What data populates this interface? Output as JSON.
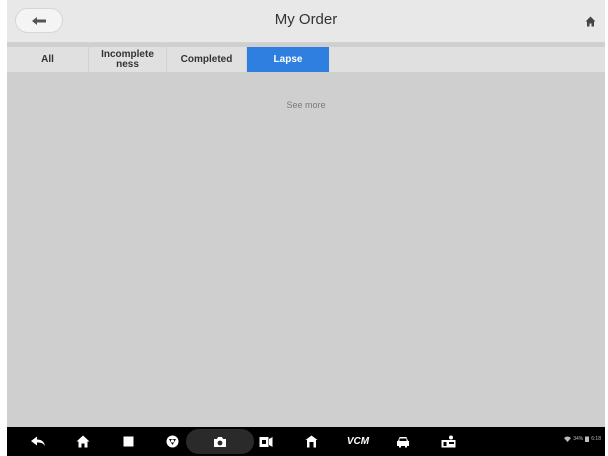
{
  "header": {
    "title": "My Order",
    "back_icon": "back-arrow-icon",
    "home_icon": "home-icon"
  },
  "tabs": [
    {
      "label": "All",
      "active": false
    },
    {
      "label": "Incomplete\nness",
      "active": false
    },
    {
      "label": "Completed",
      "active": false
    },
    {
      "label": "Lapse",
      "active": true
    }
  ],
  "content": {
    "see_more": "See more"
  },
  "navbar": {
    "icons": [
      "back-icon",
      "home-icon",
      "recent-apps-icon",
      "browser-icon",
      "camera-icon",
      "screen-record-icon",
      "repair-shop-icon",
      "vci-icon",
      "vehicle-icon",
      "dealer-icon"
    ],
    "vcm_label": "VCM",
    "status": {
      "wifi_icon": "wifi-icon",
      "battery_text": "34%",
      "time_text": "6:18"
    }
  },
  "colors": {
    "accent": "#2f7fe0",
    "background": "#cfcfcf",
    "header": "#e8e8e8",
    "navbar": "#000000"
  }
}
